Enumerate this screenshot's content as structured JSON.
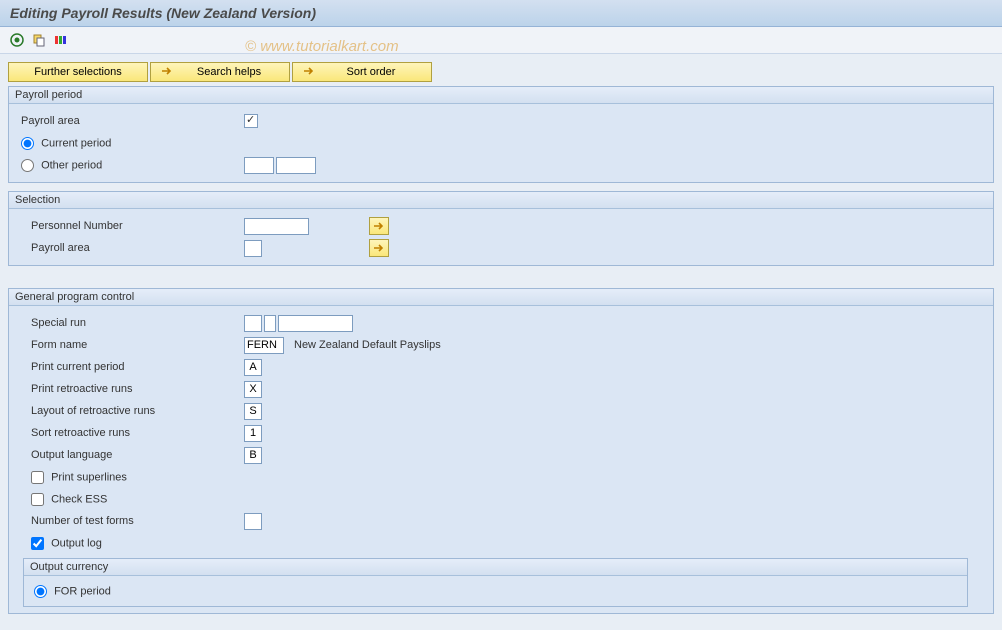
{
  "title": "Editing Payroll Results (New Zealand Version)",
  "watermark": "© www.tutorialkart.com",
  "buttons": {
    "further_selections": "Further selections",
    "search_helps": "Search helps",
    "sort_order": "Sort order"
  },
  "payroll_period": {
    "header": "Payroll period",
    "payroll_area_label": "Payroll area",
    "payroll_area_value": "",
    "current_period_label": "Current period",
    "other_period_label": "Other period",
    "other_period_val1": "",
    "other_period_val2": ""
  },
  "selection": {
    "header": "Selection",
    "personnel_number_label": "Personnel Number",
    "personnel_number_value": "",
    "payroll_area_label": "Payroll area",
    "payroll_area_value": ""
  },
  "general": {
    "header": "General program control",
    "special_run_label": "Special run",
    "special_run_v1": "",
    "special_run_v2": "",
    "special_run_v3": "",
    "form_name_label": "Form name",
    "form_name_value": "FERN",
    "form_name_desc": "New Zealand Default Payslips",
    "print_current_label": "Print current period",
    "print_current_value": "A",
    "print_retro_label": "Print retroactive runs",
    "print_retro_value": "X",
    "layout_retro_label": "Layout of retroactive runs",
    "layout_retro_value": "S",
    "sort_retro_label": "Sort retroactive runs",
    "sort_retro_value": "1",
    "output_lang_label": "Output language",
    "output_lang_value": "B",
    "print_superlines_label": "Print superlines",
    "check_ess_label": "Check ESS",
    "num_test_forms_label": "Number of test forms",
    "num_test_forms_value": "",
    "output_log_label": "Output log",
    "output_currency": {
      "header": "Output currency",
      "for_period_label": "FOR period"
    }
  }
}
